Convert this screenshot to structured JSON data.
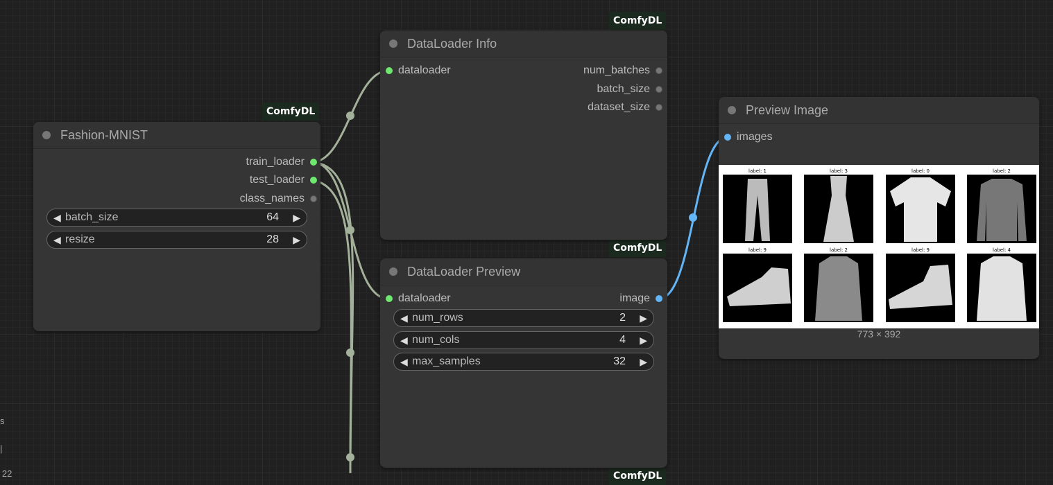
{
  "badge_text": "ComfyDL",
  "nodes": {
    "fashion": {
      "title": "Fashion-MNIST",
      "outputs": [
        "train_loader",
        "test_loader",
        "class_names"
      ],
      "widgets": [
        {
          "name": "batch_size",
          "value": "64"
        },
        {
          "name": "resize",
          "value": "28"
        }
      ]
    },
    "info": {
      "title": "DataLoader Info",
      "input": "dataloader",
      "outputs": [
        "num_batches",
        "batch_size",
        "dataset_size"
      ]
    },
    "preview_loader": {
      "title": "DataLoader Preview",
      "input": "dataloader",
      "output": "image",
      "widgets": [
        {
          "name": "num_rows",
          "value": "2"
        },
        {
          "name": "num_cols",
          "value": "4"
        },
        {
          "name": "max_samples",
          "value": "32"
        }
      ]
    },
    "preview_image": {
      "title": "Preview Image",
      "input": "images",
      "grid_labels": [
        "label: 1",
        "label: 3",
        "label: 0",
        "label: 2",
        "label: 9",
        "label: 2",
        "label: 9",
        "label: 4"
      ],
      "dimensions": "773 × 392"
    }
  },
  "colors": {
    "link_gray": "#a3b09a",
    "link_blue": "#64b5f6",
    "pin_green": "#6ee86e",
    "badge_bg": "#1b2a1e"
  },
  "partial_texts": {
    "left_edge_1": "s",
    "left_edge_2": "|",
    "left_edge_3": "2 22",
    "bottom_badge": "ComfyDL"
  }
}
